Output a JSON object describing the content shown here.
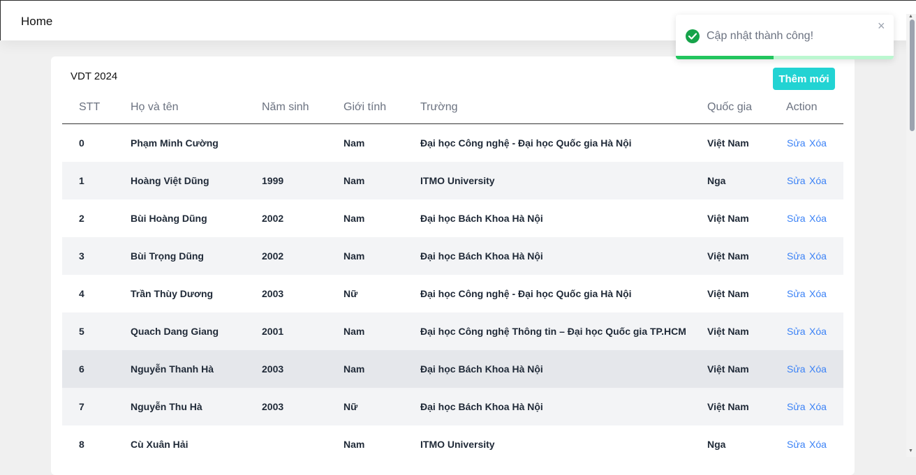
{
  "header": {
    "title": "Home"
  },
  "card": {
    "title": "VDT 2024",
    "add_button": "Thêm mới"
  },
  "table": {
    "columns": [
      "STT",
      "Họ và tên",
      "Năm sinh",
      "Giới tính",
      "Trường",
      "Quốc gia",
      "Action"
    ],
    "rows": [
      {
        "stt": "0",
        "name": "Phạm Minh Cường",
        "year": "",
        "gender": "Nam",
        "school": "Đại học Công nghệ - Đại học Quốc gia Hà Nội",
        "country": "Việt Nam",
        "edit": "Sửa",
        "delete": "Xóa"
      },
      {
        "stt": "1",
        "name": "Hoàng Việt Dũng",
        "year": "1999",
        "gender": "Nam",
        "school": "ITMO University",
        "country": "Nga",
        "edit": "Sửa",
        "delete": "Xóa"
      },
      {
        "stt": "2",
        "name": "Bùi Hoàng Dũng",
        "year": "2002",
        "gender": "Nam",
        "school": "Đại học Bách Khoa Hà Nội",
        "country": "Việt Nam",
        "edit": "Sửa",
        "delete": "Xóa"
      },
      {
        "stt": "3",
        "name": "Bùi Trọng Dũng",
        "year": "2002",
        "gender": "Nam",
        "school": "Đại học Bách Khoa Hà Nội",
        "country": "Việt Nam",
        "edit": "Sửa",
        "delete": "Xóa"
      },
      {
        "stt": "4",
        "name": "Trần Thùy Dương",
        "year": "2003",
        "gender": "Nữ",
        "school": "Đại học Công nghệ - Đại học Quốc gia Hà Nội",
        "country": "Việt Nam",
        "edit": "Sửa",
        "delete": "Xóa"
      },
      {
        "stt": "5",
        "name": "Quach Dang Giang",
        "year": "2001",
        "gender": "Nam",
        "school": "Đại học Công nghệ Thông tin – Đại học Quốc gia TP.HCM",
        "country": "Việt Nam",
        "edit": "Sửa",
        "delete": "Xóa"
      },
      {
        "stt": "6",
        "name": "Nguyễn Thanh Hà",
        "year": "2003",
        "gender": "Nam",
        "school": "Đại học Bách Khoa Hà Nội",
        "country": "Việt Nam",
        "edit": "Sửa",
        "delete": "Xóa"
      },
      {
        "stt": "7",
        "name": "Nguyễn Thu Hà",
        "year": "2003",
        "gender": "Nữ",
        "school": "Đại học Bách Khoa Hà Nội",
        "country": "Việt Nam",
        "edit": "Sửa",
        "delete": "Xóa"
      },
      {
        "stt": "8",
        "name": "Cù Xuân Hải",
        "year": "",
        "gender": "Nam",
        "school": "ITMO University",
        "country": "Nga",
        "edit": "Sửa",
        "delete": "Xóa"
      }
    ]
  },
  "toast": {
    "message": "Cập nhật thành công!",
    "close_glyph": "×",
    "icon": "check-circle-icon",
    "progress": 0.45
  },
  "colors": {
    "accent": "#22d3d3",
    "link": "#3b82f6",
    "success": "#16a34a"
  }
}
